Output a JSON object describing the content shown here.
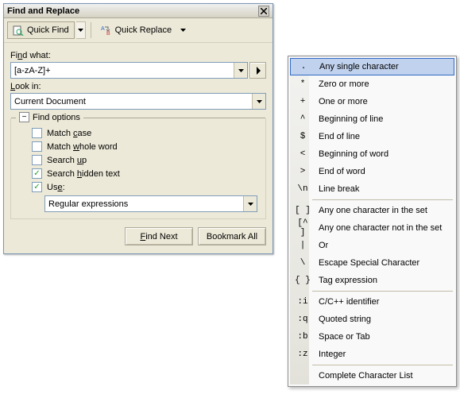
{
  "title": "Find and Replace",
  "toolbar": {
    "quick_find": "Quick Find",
    "quick_replace": "Quick Replace"
  },
  "labels": {
    "find_what": "Find what:",
    "look_in": "Look in:",
    "find_options": "Find options"
  },
  "inputs": {
    "find_value": "[a-zA-Z]+",
    "look_in_value": "Current Document"
  },
  "options": {
    "match_case": {
      "label_pre": "Match ",
      "u": "c",
      "label_post": "ase",
      "checked": false
    },
    "whole_word": {
      "label_pre": "Match ",
      "u": "w",
      "label_post": "hole word",
      "checked": false
    },
    "search_up": {
      "label_pre": "Search ",
      "u": "u",
      "label_post": "p",
      "checked": false
    },
    "hidden": {
      "label_pre": "Search ",
      "u": "h",
      "label_post": "idden text",
      "checked": true
    },
    "use": {
      "label_pre": "Us",
      "u": "e",
      "label_post": ":",
      "checked": true
    }
  },
  "use_value": "Regular expressions",
  "buttons": {
    "find_next_pre": "",
    "find_next_u": "F",
    "find_next_post": "ind Next",
    "bookmark": "Bookmark All"
  },
  "menu": [
    {
      "sym": ".",
      "txt": "Any single character",
      "hl": true
    },
    {
      "sym": "*",
      "txt": "Zero or more"
    },
    {
      "sym": "+",
      "txt": "One or more"
    },
    {
      "sym": "^",
      "txt": "Beginning of line"
    },
    {
      "sym": "$",
      "txt": "End of line"
    },
    {
      "sym": "<",
      "txt": "Beginning of word"
    },
    {
      "sym": ">",
      "txt": "End of word"
    },
    {
      "sym": "\\n",
      "txt": "Line break"
    },
    {
      "sep": true
    },
    {
      "sym": "[ ]",
      "txt": "Any one character in the set"
    },
    {
      "sym": "[^ ]",
      "txt": "Any one character not in the set"
    },
    {
      "sym": "|",
      "txt": "Or"
    },
    {
      "sym": "\\",
      "txt": "Escape Special Character"
    },
    {
      "sym": "{ }",
      "txt": "Tag expression"
    },
    {
      "sep": true
    },
    {
      "sym": ":i",
      "txt": "C/C++ identifier"
    },
    {
      "sym": ":q",
      "txt": "Quoted string"
    },
    {
      "sym": ":b",
      "txt": "Space or Tab"
    },
    {
      "sym": ":z",
      "txt": "Integer"
    },
    {
      "sep": true
    },
    {
      "sym": "",
      "txt": "Complete Character List"
    }
  ]
}
